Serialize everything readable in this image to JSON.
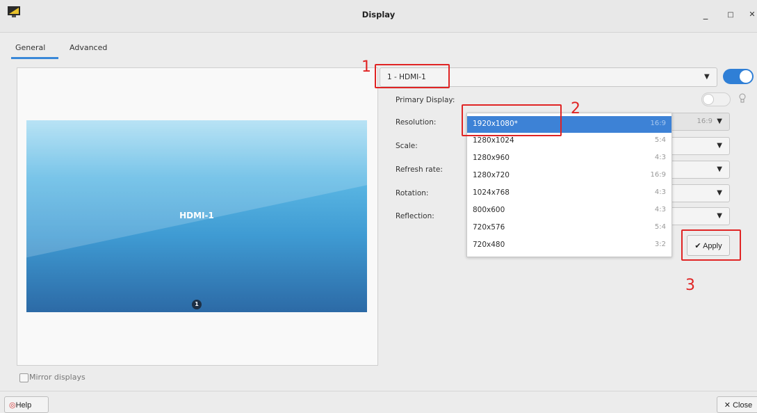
{
  "window": {
    "title": "Display",
    "minimize": "_",
    "maximize": "□",
    "close": "✕"
  },
  "tabs": [
    {
      "label": "General"
    },
    {
      "label": "Advanced"
    }
  ],
  "preview": {
    "monitor_label": "HDMI-1",
    "badge": "1"
  },
  "mirror": {
    "label": "Mirror displays"
  },
  "display_select": {
    "value": "1 - HDMI-1"
  },
  "settings": {
    "primary_display": "Primary Display:",
    "resolution": "Resolution:",
    "scale": "Scale:",
    "refresh_rate": "Refresh rate:",
    "rotation": "Rotation:",
    "reflection": "Reflection:"
  },
  "resolution_ratio": "16:9",
  "resolution_options": [
    {
      "res": "1920x1080*",
      "ratio": "16:9",
      "selected": true
    },
    {
      "res": "1280x1024",
      "ratio": "5:4"
    },
    {
      "res": "1280x960",
      "ratio": "4:3"
    },
    {
      "res": "1280x720",
      "ratio": "16:9"
    },
    {
      "res": "1024x768",
      "ratio": "4:3"
    },
    {
      "res": "800x600",
      "ratio": "4:3"
    },
    {
      "res": "720x576",
      "ratio": "5:4"
    },
    {
      "res": "720x480",
      "ratio": "3:2"
    }
  ],
  "buttons": {
    "apply": "✔ Apply",
    "help": "Help",
    "close": "✕ Close"
  },
  "annotations": {
    "n1": "1",
    "n2": "2",
    "n3": "3"
  },
  "colors": {
    "accent": "#3d82d6",
    "annotation": "#e02424"
  }
}
